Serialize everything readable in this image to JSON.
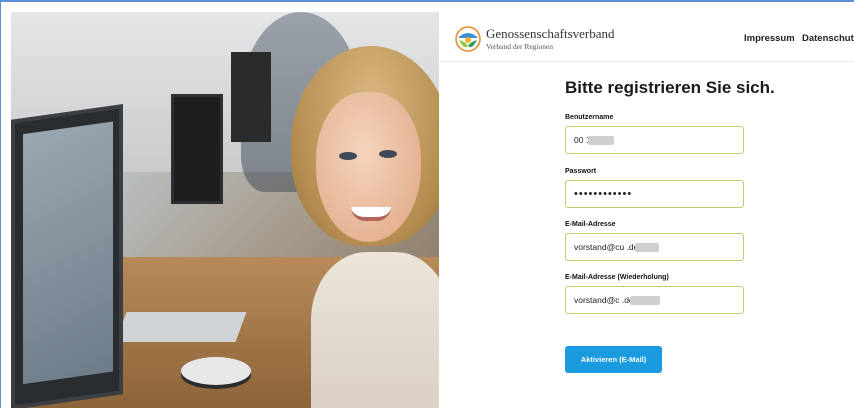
{
  "header": {
    "brand_name": "Genossenschaftsverband",
    "brand_sub": "Verband der Regionen",
    "nav": [
      {
        "label": "Impressum"
      },
      {
        "label": "Datenschutz"
      }
    ]
  },
  "form": {
    "title": "Bitte registrieren Sie sich.",
    "fields": [
      {
        "label": "Benutzername",
        "value": "00      1"
      },
      {
        "label": "Passwort",
        "value": "••••••••••••"
      },
      {
        "label": "E-Mail-Adresse",
        "value": "vorstand@cu      .de"
      },
      {
        "label": "E-Mail-Adresse (Wiederholung)",
        "value": "vorstand@c        .de"
      }
    ],
    "submit_label": "Aktivieren (E-Mail)"
  },
  "colors": {
    "accent": "#1a9be0",
    "input_border": "#b9d06a",
    "frame": "#5b8fd6"
  },
  "icons": {
    "logo": "genossenschaftsverband-logo-icon"
  }
}
